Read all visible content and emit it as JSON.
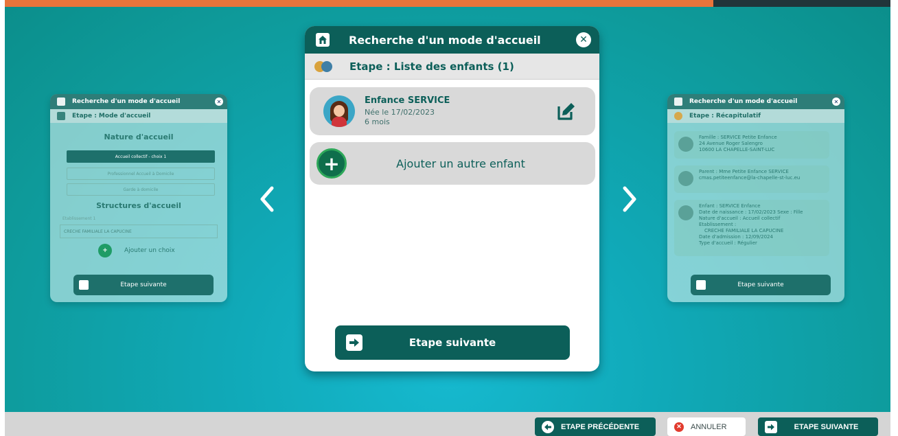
{
  "progress": {
    "percent": 80,
    "fill_color": "#e8743b"
  },
  "modal": {
    "title": "Recherche d'un mode d'accueil",
    "step_label": "Etape : Liste des enfants (1)",
    "child": {
      "name": "Enfance SERVICE",
      "birth": "Née le 17/02/2023",
      "age": "6 mois"
    },
    "add_child_label": "Ajouter un autre enfant",
    "next_label": "Etape suivante"
  },
  "left_card": {
    "title": "Recherche d'un mode d'accueil",
    "step_label": "Etape : Mode d'accueil",
    "section1": "Nature d'accueil",
    "options": [
      "Accueil collectif - choix 1",
      "Professionnel Accueil à Domicile",
      "Garde à domicile"
    ],
    "section2": "Structures d'accueil",
    "field_label": "Etablissement 1",
    "field_value": "CRECHE FAMILIALE LA CAPUCINE",
    "add_choice": "Ajouter un choix",
    "next_label": "Etape suivante"
  },
  "right_card": {
    "title": "Recherche d'un mode d'accueil",
    "step_label": "Etape : Récapitulatif",
    "family": {
      "line1": "Famille : SERVICE Petite Enfance",
      "line2": "24 Avenue Roger Salengro",
      "line3": "10600 LA CHAPELLE-SAINT-LUC"
    },
    "parent": {
      "line1": "Parent : Mme Petite Enfance SERVICE",
      "line2": "cmas.petiteenfance@la-chapelle-st-luc.eu"
    },
    "child": {
      "line1": "Enfant : SERVICE Enfance",
      "line2": "Date de naissance : 17/02/2023   Sexe : Fille",
      "line3": "Nature d'accueil : Accueil collectif",
      "line4": "Etablissement :",
      "line5": "CRECHE FAMILIALE LA CAPUCINE",
      "line6": "Date d'admission : 12/09/2024",
      "line7": "Type d'accueil : Régulier"
    },
    "next_label": "Etape suivante"
  },
  "toolbar": {
    "prev_label": "ETAPE PRÉCÉDENTE",
    "cancel_label": "ANNULER",
    "next_label": "ETAPE SUIVANTE"
  },
  "icons": [
    "home-icon",
    "close-icon",
    "children-icon",
    "child-avatar-icon",
    "edit-icon",
    "plus-icon",
    "arrow-right-icon",
    "chevron-left-icon",
    "chevron-right-icon",
    "arrow-left-icon",
    "cancel-x-icon"
  ]
}
